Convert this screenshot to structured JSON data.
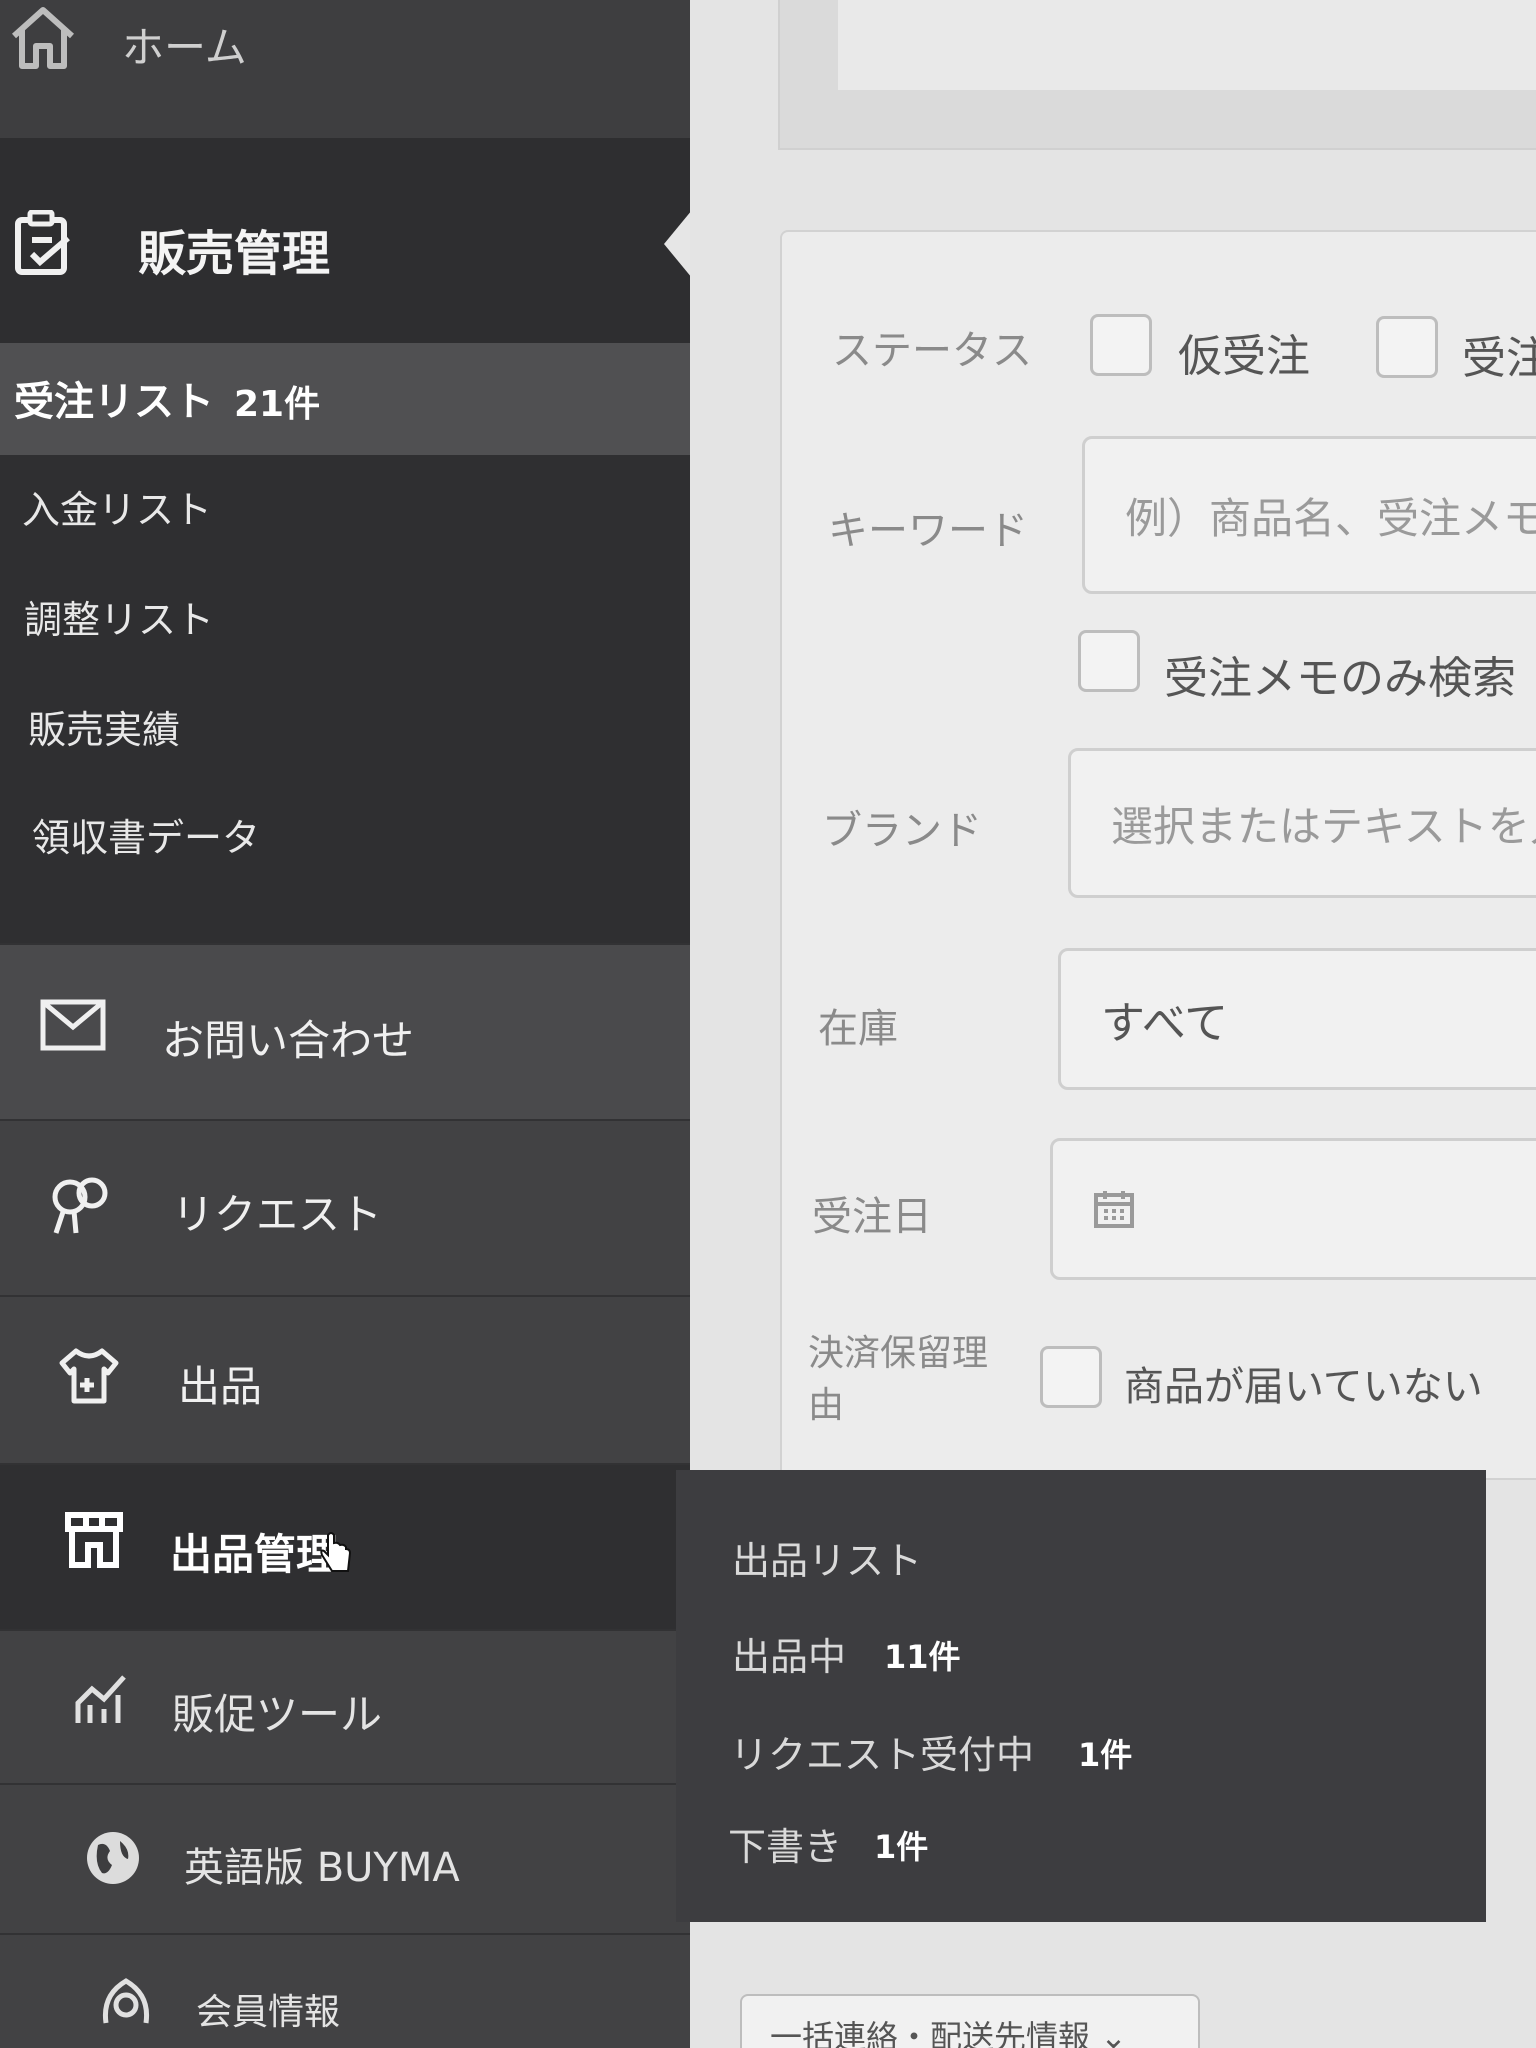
{
  "sidebar": {
    "home_label": "ホーム",
    "section_label": "販売管理",
    "active_sub": {
      "label": "受注リスト",
      "count": "21件"
    },
    "sub_items": [
      "入金リスト",
      "調整リスト",
      "販売実績",
      "領収書データ"
    ],
    "nav": {
      "inquiry": "お問い合わせ",
      "request": "リクエスト",
      "listing": "出品",
      "listing_mgmt": "出品管理",
      "promo": "販促ツール",
      "english": "英語版 BUYMA",
      "member": "会員情報"
    },
    "icons": {
      "home": "home-icon",
      "sales": "clipboard-check-icon",
      "inquiry": "mail-icon",
      "request": "request-icon",
      "listing": "shirt-plus-icon",
      "listing_mgmt": "storefront-icon",
      "promo": "chart-icon",
      "english": "globe-icon",
      "member": "member-icon"
    }
  },
  "form": {
    "status": {
      "label": "ステータス",
      "opt1": "仮受注",
      "opt2": "受注"
    },
    "keyword": {
      "label": "キーワード",
      "placeholder": "例）商品名、受注メモ",
      "memo_only": "受注メモのみ検索"
    },
    "brand": {
      "label": "ブランド",
      "placeholder": "選択またはテキストを入力"
    },
    "stock": {
      "label": "在庫",
      "value": "すべて"
    },
    "order_date": {
      "label": "受注日"
    },
    "hold_reason": {
      "label_line1": "決済保留理",
      "label_line2": "由",
      "opt1": "商品が届いていない"
    }
  },
  "flyout": {
    "items": [
      {
        "label": "出品リスト",
        "count": ""
      },
      {
        "label": "出品中",
        "count": "11件"
      },
      {
        "label": "リクエスト受付中",
        "count": "1件"
      },
      {
        "label": "下書き",
        "count": "1件"
      }
    ]
  },
  "bulk_button": "一括連絡・配送先情報 ⌄",
  "colors": {
    "sidebar": "#3d3d3f",
    "sidebar_dark": "#2f2f31",
    "main_bg": "#e4e4e4"
  }
}
